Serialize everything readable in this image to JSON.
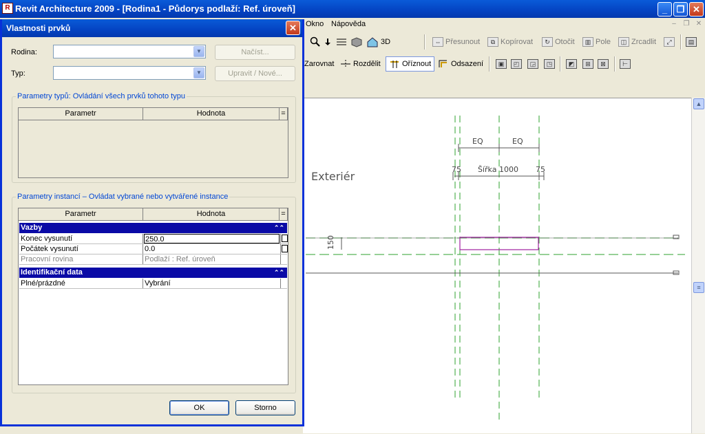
{
  "app": {
    "title": "Revit Architecture 2009 - [Rodina1 - Půdorys podlaží: Ref. úroveň]",
    "icon_letter": "R",
    "minimize": "_",
    "restore": "❐",
    "close": "✕"
  },
  "menubar": {
    "items": [
      "Okno",
      "Nápověda"
    ],
    "mdi_min": "–",
    "mdi_restore": "❐",
    "mdi_close": "✕"
  },
  "toolbar1": {
    "view3d": "3D",
    "move": "Přesunout",
    "copy": "Kopírovat",
    "rotate": "Otočit",
    "array": "Pole",
    "mirror": "Zrcadlit"
  },
  "toolbar2": {
    "align": "Zarovnat",
    "split": "Rozdělit",
    "trim": "Oříznout",
    "offset": "Odsazení"
  },
  "canvas": {
    "exterior_label": "Exteriér",
    "dim_eq_left": "EQ",
    "dim_eq_right": "EQ",
    "dim_left": "75",
    "dim_width": "Šířka 1000",
    "dim_right": "75",
    "dim_height": "150"
  },
  "dialog": {
    "title": "Vlastnosti prvků",
    "close": "✕",
    "family_label": "Rodina:",
    "family_value": "",
    "load_button": "Načíst...",
    "type_label": "Typ:",
    "type_value": "",
    "edit_new_button": "Upravit / Nové...",
    "type_params_title": "Parametry typů: Ovládání všech prvků tohoto typu",
    "instance_params_title": "Parametry instancí – Ovládat vybrané nebo vytvářené instance",
    "col_param": "Parametr",
    "col_value": "Hodnota",
    "col_eq": "=",
    "categories": [
      {
        "name": "Vazby",
        "rows": [
          {
            "key": "Konec vysunutí",
            "value": "250.0"
          },
          {
            "key": "Počátek vysunutí",
            "value": "0.0"
          },
          {
            "key": "Pracovní rovina",
            "value": "Podlaží : Ref. úroveň"
          }
        ]
      },
      {
        "name": "Identifikační data",
        "rows": [
          {
            "key": "Plné/prázdné",
            "value": "Vybrání"
          }
        ]
      }
    ],
    "collapse_glyph": "⌃⌃",
    "ok_button": "OK",
    "cancel_button": "Storno"
  },
  "colors": {
    "titlebar": "#0443c2",
    "category_header": "#0a0aa6",
    "selection_magenta": "#a020a0",
    "ref_plane_green": "#2ca02c"
  }
}
